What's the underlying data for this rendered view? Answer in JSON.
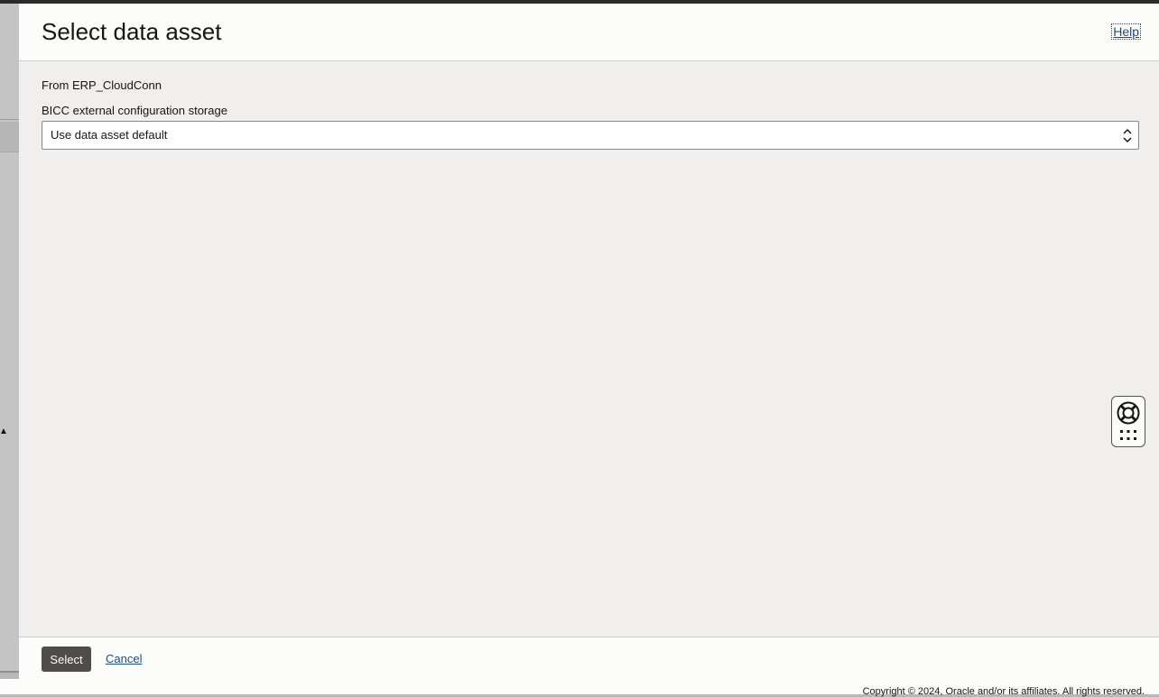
{
  "drawer": {
    "title": "Select data asset",
    "help_label": "Help",
    "source_text": "From ERP_CloudConn",
    "field": {
      "label": "BICC external configuration storage",
      "selected_value": "Use data asset default"
    },
    "footer": {
      "select_label": "Select",
      "cancel_label": "Cancel"
    }
  },
  "floating_widget": {
    "icons": [
      "lifebuoy-icon",
      "apps-grid-icon"
    ]
  },
  "copyright": "Copyright © 2024, Oracle and/or its affiliates. All rights reserved.",
  "colors": {
    "primary_button": "#4f4c4a",
    "link": "#1f4c80",
    "panel_background": "#f1efed"
  }
}
